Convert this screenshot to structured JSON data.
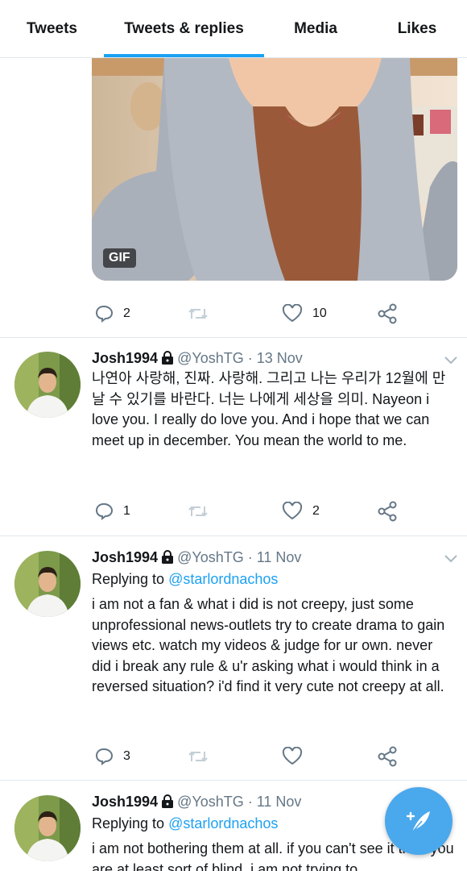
{
  "tabs": [
    {
      "label": "Tweets"
    },
    {
      "label": "Tweets & replies"
    },
    {
      "label": "Media"
    },
    {
      "label": "Likes"
    }
  ],
  "media": {
    "badge": "GIF"
  },
  "top_actions": {
    "reply_count": "2",
    "retweet_count": "",
    "like_count": "10"
  },
  "tweets": [
    {
      "name": "Josh1994",
      "handle": "@YoshTG",
      "date": "· 13 Nov",
      "replying_prefix": "",
      "replying_to": "",
      "text": "나연아 사랑해, 진짜. 사랑해. 그리고 나는 우리가 12월에 만날 수 있기를 바란다. 너는 나에게 세상을 의미. Nayeon i love you. I really do love you. And i hope that we can meet up in december. You mean the world to me.",
      "reply_count": "1",
      "like_count": "2"
    },
    {
      "name": "Josh1994",
      "handle": "@YoshTG",
      "date": "· 11 Nov",
      "replying_prefix": "Replying to",
      "replying_to": "@starlordnachos",
      "text": "i am not a fan & what i did is not creepy, just some unprofessional news-outlets try to create drama to gain views etc. watch my videos & judge for ur own. never did i break any rule & u'r asking what i would think in a reversed situation? i'd find it very cute not creepy at all.",
      "reply_count": "3",
      "like_count": ""
    },
    {
      "name": "Josh1994",
      "handle": "@YoshTG",
      "date": "· 11 Nov",
      "replying_prefix": "Replying to",
      "replying_to": "@starlordnachos",
      "text": "i am not bothering them at all. if you can't see it then you are at least sort of blind. i am not trying to",
      "reply_count": "",
      "like_count": ""
    }
  ],
  "colors": {
    "accent": "#1da1f2",
    "fab": "#4aa8ed",
    "secondary": "#657786",
    "divider": "#e1e8ed"
  }
}
